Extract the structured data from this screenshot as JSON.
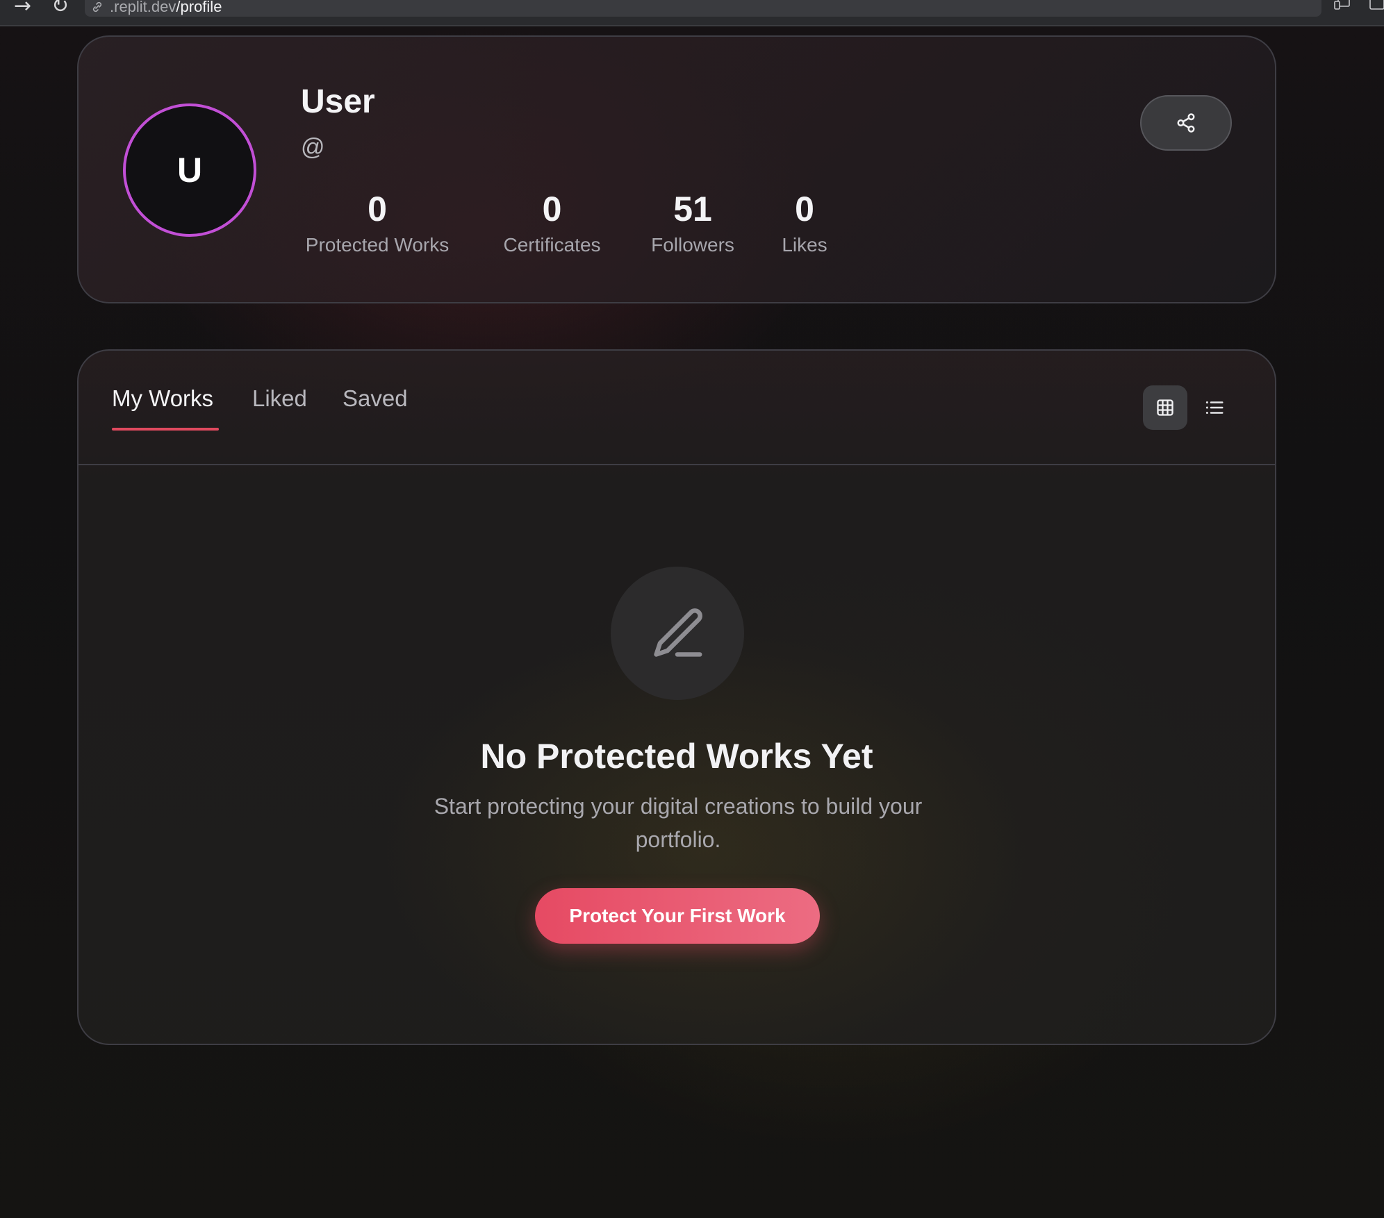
{
  "browser": {
    "url_host": ".replit.dev",
    "url_path": "/profile"
  },
  "profile": {
    "avatar_initial": "U",
    "name": "User",
    "handle": "@",
    "stats": [
      {
        "value": "0",
        "label": "Protected Works"
      },
      {
        "value": "0",
        "label": "Certificates"
      },
      {
        "value": "51",
        "label": "Followers"
      },
      {
        "value": "0",
        "label": "Likes"
      }
    ],
    "share_icon": "share-icon"
  },
  "works": {
    "tabs": [
      {
        "label": "My Works",
        "active": true
      },
      {
        "label": "Liked",
        "active": false
      },
      {
        "label": "Saved",
        "active": false
      }
    ],
    "view_modes": [
      {
        "icon": "grid-icon",
        "active": true
      },
      {
        "icon": "list-icon",
        "active": false
      }
    ],
    "empty_state": {
      "icon": "pen-icon",
      "title": "No Protected Works Yet",
      "subtitle": "Start protecting your digital creations to build your portfolio.",
      "cta_label": "Protect Your First Work"
    }
  },
  "colors": {
    "accent": "#e64a63",
    "avatar_ring": "#c24fd6",
    "card_border": "#3e3d44"
  }
}
